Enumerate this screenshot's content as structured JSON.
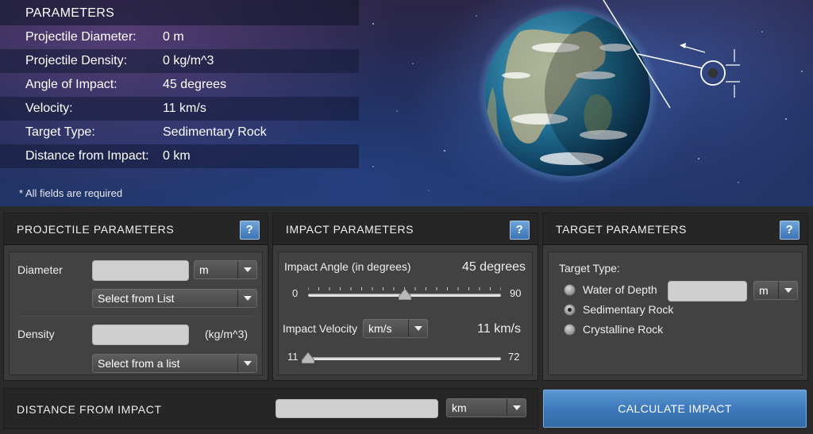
{
  "summary": {
    "title": "PARAMETERS",
    "rows": [
      {
        "label": "Projectile Diameter:",
        "value": "0 m"
      },
      {
        "label": "Projectile Density:",
        "value": "0 kg/m^3"
      },
      {
        "label": "Angle of Impact:",
        "value": "45 degrees"
      },
      {
        "label": "Velocity:",
        "value": "11 km/s"
      },
      {
        "label": "Target Type:",
        "value": "Sedimentary Rock"
      },
      {
        "label": "Distance from Impact:",
        "value": "0 km"
      }
    ],
    "required_note": "* All fields are required"
  },
  "projectile": {
    "title": "PROJECTILE PARAMETERS",
    "help": "?",
    "diameter_label": "Diameter",
    "diameter_value": "",
    "diameter_unit": "m",
    "diameter_list": "Select from List",
    "density_label": "Density",
    "density_value": "",
    "density_unit": "(kg/m^3)",
    "density_list": "Select from a list"
  },
  "impact": {
    "title": "IMPACT PARAMETERS",
    "help": "?",
    "angle_label": "Impact Angle (in degrees)",
    "angle_value": "45 degrees",
    "angle_min": "0",
    "angle_max": "90",
    "angle_fraction": 0.5,
    "velocity_label": "Impact Velocity",
    "velocity_unit": "km/s",
    "velocity_value": "11 km/s",
    "velocity_min": "11",
    "velocity_max": "72",
    "velocity_fraction": 0.0
  },
  "target": {
    "title": "TARGET PARAMETERS",
    "help": "?",
    "type_label": "Target Type:",
    "options": [
      "Water of Depth",
      "Sedimentary Rock",
      "Crystalline Rock"
    ],
    "selected": "Sedimentary Rock",
    "depth_value": "",
    "depth_unit": "m"
  },
  "distance": {
    "label": "DISTANCE FROM IMPACT",
    "value": "",
    "unit": "km"
  },
  "calculate_label": "CALCULATE IMPACT",
  "colors": {
    "accent": "#3e79bb",
    "panel": "#3b3b3b",
    "header": "#262626"
  }
}
